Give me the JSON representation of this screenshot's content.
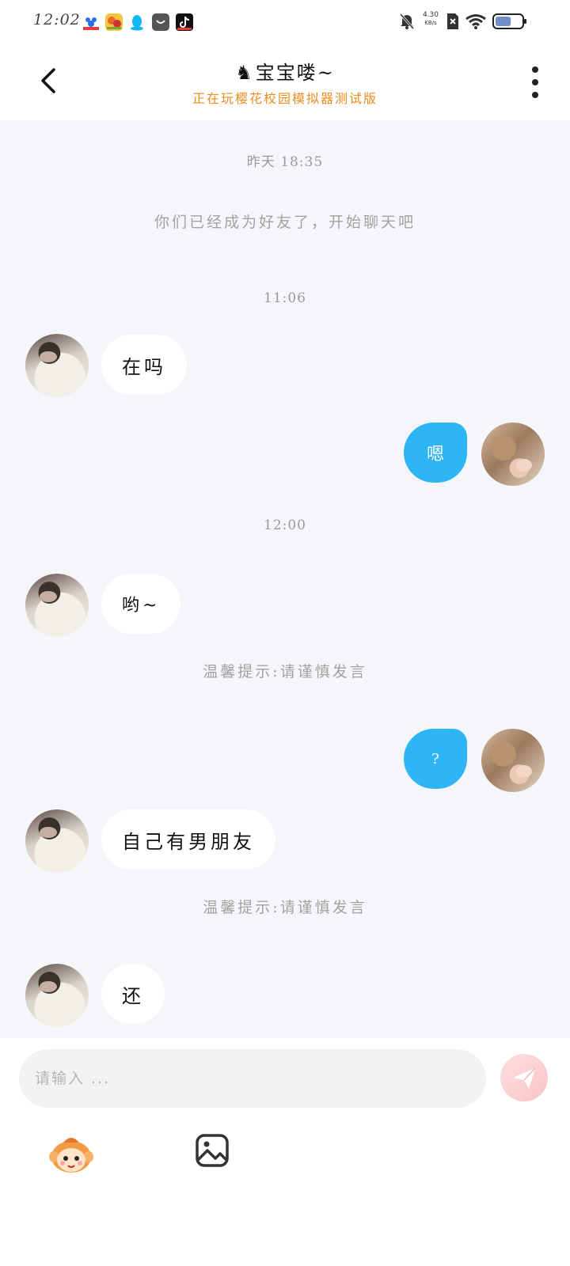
{
  "status_bar": {
    "time": "12:02",
    "net_speed_value": "4.30",
    "net_speed_unit": "KB/s",
    "apps": [
      "baidu-netdisk-icon",
      "game-app-icon",
      "qq-icon",
      "store-icon",
      "tiktok-icon"
    ],
    "battery_level": 0.6
  },
  "header": {
    "title_prefix": "♞",
    "title": "宝宝喽~",
    "subtitle": "正在玩樱花校园模拟器测试版"
  },
  "chat": {
    "ts1": "昨天 18:35",
    "system_friend": "你们已经成为好友了，开始聊天吧",
    "ts2": "11:06",
    "ts3": "12:00",
    "tip1": "温馨提示:请谨慎发言",
    "tip2": "温馨提示:请谨慎发言",
    "messages": [
      {
        "side": "left",
        "text": "在吗"
      },
      {
        "side": "right",
        "text": "嗯"
      },
      {
        "side": "left",
        "text": "哟~"
      },
      {
        "side": "right",
        "text": "?"
      },
      {
        "side": "left",
        "text": "自己有男朋友"
      },
      {
        "side": "left",
        "text": "还"
      }
    ]
  },
  "input": {
    "placeholder": "请输入 ..."
  },
  "colors": {
    "accent_blue": "#2db5f5",
    "subtitle_orange": "#f08c1e",
    "chat_bg": "#f4f6f9",
    "send_pink": "#f9c4c6"
  }
}
